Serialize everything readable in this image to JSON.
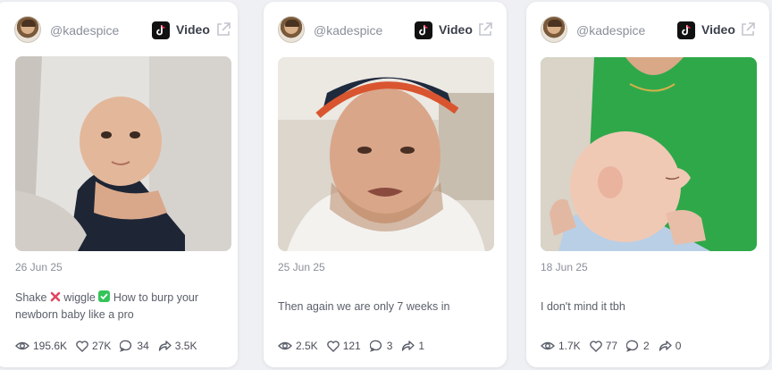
{
  "cards": [
    {
      "handle": "@kadespice",
      "platform_label": "Video",
      "date": "26 Jun 25",
      "caption_parts": [
        "Shake",
        "wiggle",
        "How to burp your newborn baby like a pro"
      ],
      "stats": {
        "views": "195.6K",
        "likes": "27K",
        "comments": "34",
        "shares": "3.5K"
      }
    },
    {
      "handle": "@kadespice",
      "platform_label": "Video",
      "date": "25 Jun 25",
      "caption": "Then again we are only 7 weeks in",
      "stats": {
        "views": "2.5K",
        "likes": "121",
        "comments": "3",
        "shares": "1"
      }
    },
    {
      "handle": "@kadespice",
      "platform_label": "Video",
      "date": "18 Jun 25",
      "caption": "I don't mind it tbh",
      "stats": {
        "views": "1.7K",
        "likes": "77",
        "comments": "2",
        "shares": "0"
      }
    }
  ],
  "colors": {
    "card_bg": "#ffffff",
    "page_bg": "#eef0f4",
    "muted_text": "#8a8f99",
    "check_green": "#34c45a",
    "cross_red": "#e0455f"
  },
  "icons": [
    "avatar",
    "tiktok-icon",
    "external-link-icon",
    "eye-icon",
    "heart-icon",
    "comment-icon",
    "share-icon",
    "cross-mark-icon",
    "check-mark-icon"
  ]
}
